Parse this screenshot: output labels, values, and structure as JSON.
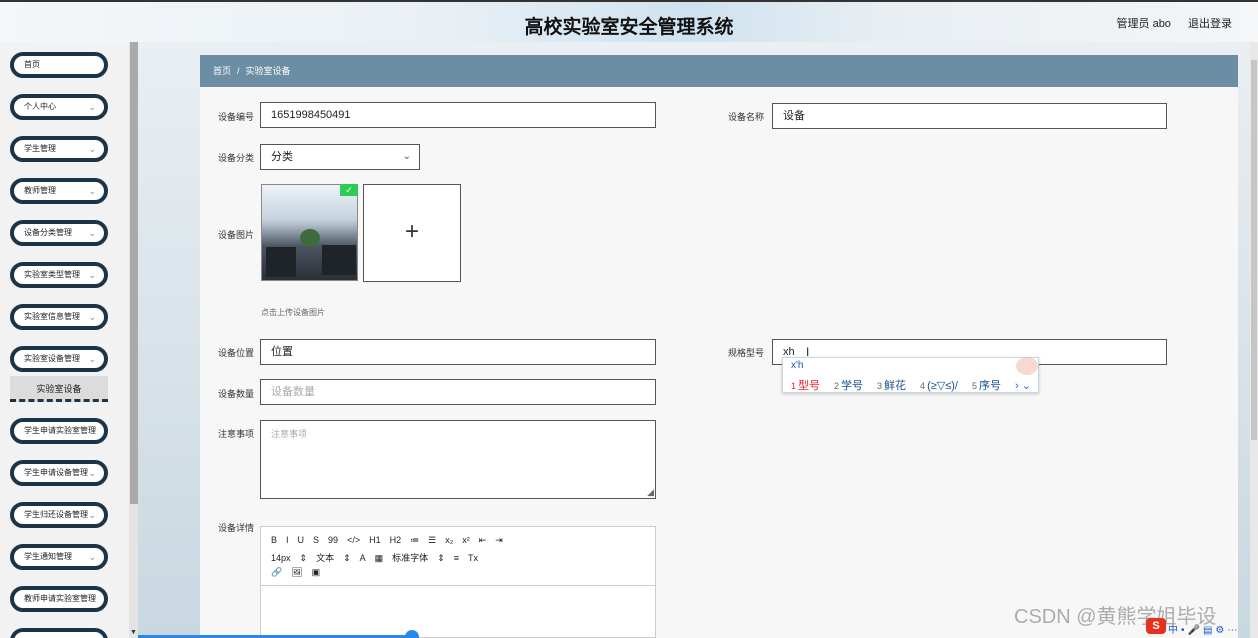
{
  "header": {
    "title": "高校实验室安全管理系统",
    "user_label": "管理员 abo",
    "logout_label": "退出登录"
  },
  "sidebar": {
    "items": [
      {
        "label": "首页",
        "has_chevron": false
      },
      {
        "label": "个人中心",
        "has_chevron": true
      },
      {
        "label": "学生管理",
        "has_chevron": true
      },
      {
        "label": "教师管理",
        "has_chevron": true
      },
      {
        "label": "设备分类管理",
        "has_chevron": true
      },
      {
        "label": "实验室类型管理",
        "has_chevron": true
      },
      {
        "label": "实验室信息管理",
        "has_chevron": true
      },
      {
        "label": "实验室设备管理",
        "has_chevron": true
      },
      {
        "label": "学生申请实验室管理",
        "has_chevron": false
      },
      {
        "label": "学生申请设备管理",
        "has_chevron": true
      },
      {
        "label": "学生归还设备管理",
        "has_chevron": true
      },
      {
        "label": "学生通知管理",
        "has_chevron": true
      },
      {
        "label": "教师申请实验室管理",
        "has_chevron": false
      }
    ],
    "active_sub": "实验室设备",
    "chevron_glyph": "⌄"
  },
  "breadcrumb": {
    "home": "首页",
    "separator": "/",
    "current": "实验室设备"
  },
  "form": {
    "device_no": {
      "label": "设备编号",
      "value": "1651998450491"
    },
    "device_name": {
      "label": "设备名称",
      "value": "设备"
    },
    "category": {
      "label": "设备分类",
      "value": "分类"
    },
    "image": {
      "label": "设备图片",
      "hint": "点击上传设备图片",
      "upload_glyph": "+",
      "ok_glyph": "✓"
    },
    "location": {
      "label": "设备位置",
      "value": "位置"
    },
    "spec": {
      "label": "规格型号",
      "value": "xh"
    },
    "quantity": {
      "label": "设备数量",
      "placeholder": "设备数量"
    },
    "notes": {
      "label": "注意事项",
      "placeholder": "注意事项"
    },
    "details": {
      "label": "设备详情"
    }
  },
  "editor": {
    "row1": [
      "B",
      "I",
      "U",
      "S",
      "99",
      "</>",
      "H1",
      "H2",
      "≔",
      "☰",
      "x₂",
      "x²",
      "⇤",
      "⇥"
    ],
    "row2": [
      "14px",
      "⇕",
      "文本",
      "⇕",
      "A",
      "▦",
      "标准字体",
      "⇕",
      "≡",
      "Tx"
    ],
    "row3": [
      "🔗",
      "🖼",
      "▣"
    ]
  },
  "ime": {
    "composition": "x'h",
    "candidates": [
      {
        "num": "1",
        "word": "型号"
      },
      {
        "num": "2",
        "word": "学号"
      },
      {
        "num": "3",
        "word": "鲜花"
      },
      {
        "num": "4",
        "word": "(≥▽≤)/"
      },
      {
        "num": "5",
        "word": "序号"
      }
    ],
    "nav": "› ⌄"
  },
  "watermark": "CSDN @黄熊学姐毕设",
  "tray": {
    "logo": "S",
    "icons": [
      "中",
      "•",
      "🎤",
      "▤",
      "⚙",
      "⋯"
    ]
  }
}
